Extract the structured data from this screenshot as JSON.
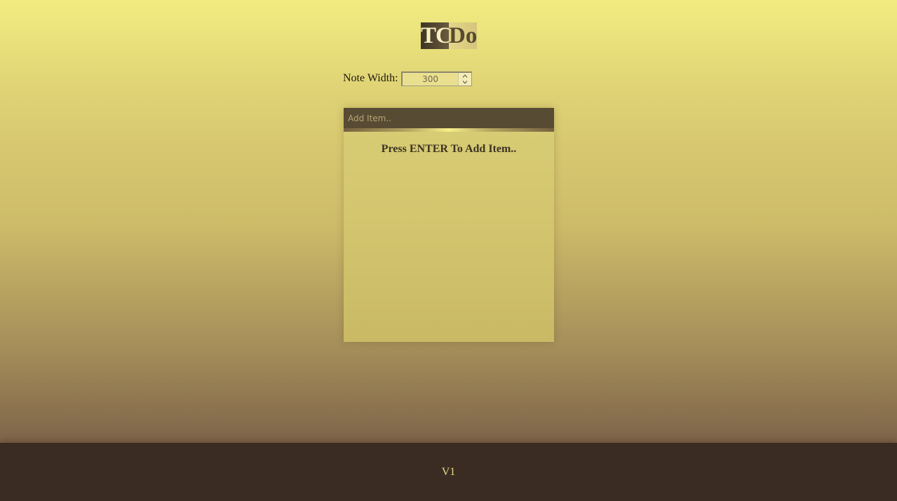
{
  "logo": {
    "part1": "TC",
    "part2": "Do"
  },
  "settings": {
    "width_label": "Note Width:",
    "width_value": "300"
  },
  "note": {
    "input_placeholder": "Add Item..",
    "hint": "Press ENTER To Add Item.."
  },
  "footer": {
    "version": "V1"
  },
  "icons": {
    "stepper_up": "chevron-up-icon",
    "stepper_down": "chevron-down-icon"
  },
  "colors": {
    "footer_bg": "#3a2c22",
    "note_header_bg": "#584b33",
    "accent": "#f6ee8a"
  }
}
